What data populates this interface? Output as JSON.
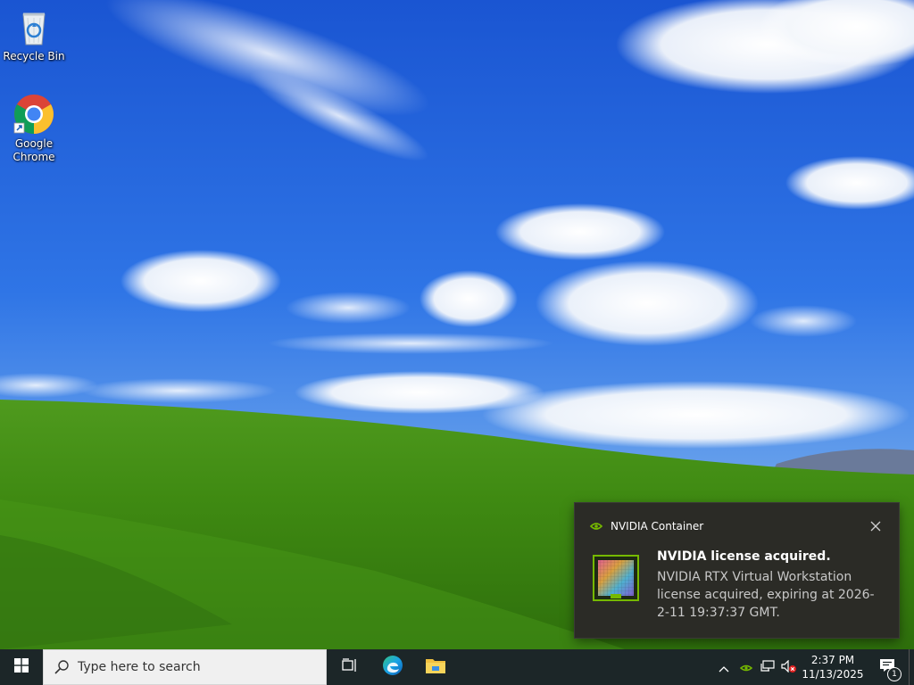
{
  "desktop": {
    "icons": [
      {
        "label": "Recycle Bin",
        "icon": "recycle-bin-icon"
      },
      {
        "label": "Google Chrome",
        "icon": "chrome-icon"
      }
    ]
  },
  "toast": {
    "app_name": "NVIDIA Container",
    "title": "NVIDIA license acquired.",
    "body": "NVIDIA RTX Virtual Workstation license acquired, expiring at 2026-2-11 19:37:37 GMT.",
    "close_icon": "close-icon",
    "accent": "#76b900"
  },
  "taskbar": {
    "search_placeholder": "Type here to search",
    "pinned": [
      "task-view-icon",
      "edge-icon",
      "file-explorer-icon"
    ],
    "tray": {
      "icons": [
        "chevron-up-icon",
        "nvidia-icon",
        "network-icon",
        "volume-muted-icon"
      ],
      "time": "2:37 PM",
      "date": "11/13/2025",
      "notification_count": "1"
    }
  },
  "colors": {
    "taskbar_bg": "#1c2628",
    "toast_bg": "#2b2b26",
    "sky": "#1f5fd6",
    "grass": "#4e9a1c"
  }
}
